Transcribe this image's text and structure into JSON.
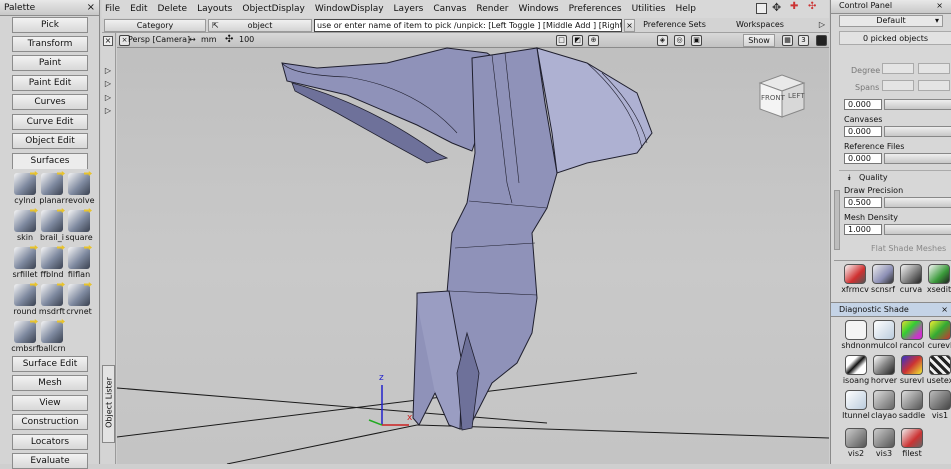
{
  "palette": {
    "title": "Palette",
    "close_glyph": "×",
    "buttons": [
      "Pick",
      "Transform",
      "Paint",
      "Paint Edit",
      "Curves",
      "Curve Edit",
      "Object Edit",
      "Surfaces"
    ],
    "surface_tools": [
      "cylnd",
      "planar",
      "revolve",
      "skin",
      "brail_i",
      "square",
      "srfillet",
      "ffblnd",
      "filflan",
      "round",
      "msdrft",
      "crvnet",
      "cmbsrf",
      "ballcrn"
    ],
    "lower_buttons": [
      "Surface Edit",
      "Mesh",
      "View",
      "Construction",
      "Locators",
      "Evaluate"
    ]
  },
  "strip": {
    "object_lister": "Object Lister"
  },
  "menubar": {
    "items": [
      "File",
      "Edit",
      "Delete",
      "Layouts",
      "ObjectDisplay",
      "WindowDisplay",
      "Layers",
      "Canvas",
      "Render",
      "Windows",
      "Preferences",
      "Utilities",
      "Help"
    ]
  },
  "toolbar": {
    "category": "Category",
    "object": "object",
    "pick_field": "use or enter name of item to pick /unpick: [Left Toggle ] [Middle Add ] [Right Unpick ]",
    "preference_sets": "Preference Sets",
    "workspaces": "Workspaces"
  },
  "viewport": {
    "camera": "Persp [Camera]",
    "unit": "mm",
    "zoom": "100",
    "show": "Show",
    "page": "3",
    "cube_front": "FRONT",
    "cube_left": "LEFT",
    "axis_z": "z",
    "axis_x": "x"
  },
  "control_panel": {
    "title": "Control Panel",
    "preset": "Default",
    "picked": "0 picked objects",
    "degree": "Degree",
    "spans": "Spans",
    "value1": "0.000",
    "canvases_label": "Canvases",
    "canvases_value": "0.000",
    "reference_label": "Reference Files",
    "reference_value": "0.000",
    "quality": "Quality",
    "draw_precision": "Draw Precision",
    "draw_precision_value": "0.500",
    "mesh_density": "Mesh Density",
    "mesh_density_value": "1.000",
    "flat_shade": "Flat Shade Meshes",
    "shelf_tools": [
      "xfrmcv",
      "scnsrf",
      "curva",
      "xsedit"
    ],
    "diagnostic_title": "Diagnostic Shade",
    "diag_tools": [
      "shdnon",
      "mulcol",
      "rancol",
      "curevl",
      "isoang",
      "horver",
      "surevl",
      "usetex",
      "ltunnel",
      "clayao",
      "saddle",
      "vis1",
      "vis2",
      "vis3",
      "filest"
    ]
  },
  "colors": {
    "model": "#8f92b9",
    "model_dark": "#6e719a",
    "model_light": "#aeb1d2",
    "axis_z": "#2222cc",
    "axis_x": "#cc2222",
    "diag_head": "#c4d3e6"
  }
}
